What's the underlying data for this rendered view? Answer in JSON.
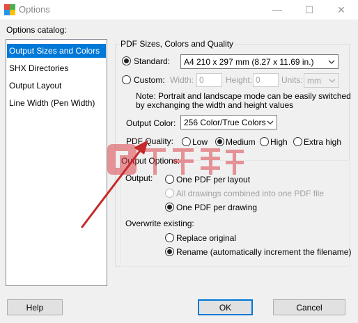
{
  "window": {
    "title": "Options",
    "minimize_glyph": "—",
    "maximize_glyph": "☐",
    "close_glyph": "✕"
  },
  "catalog": {
    "label": "Options catalog:",
    "items": [
      {
        "label": "Output Sizes and Colors",
        "selected": true
      },
      {
        "label": "SHX Directories",
        "selected": false
      },
      {
        "label": "Output Layout",
        "selected": false
      },
      {
        "label": "Line Width (Pen Width)",
        "selected": false
      }
    ]
  },
  "pdf_sizes": {
    "group_title": "PDF Sizes, Colors and Quality",
    "standard_label": "Standard:",
    "standard_value": "A4 210 x 297 mm (8.27 x 11.69 in.)",
    "custom_label": "Custom:",
    "width_label": "Width:",
    "width_value": "0",
    "height_label": "Height:",
    "height_value": "0",
    "units_label": "Units:",
    "units_value": "mm",
    "note_line1": "Note: Portrait and landscape mode can be easily switched",
    "note_line2": "by exchanging the width and height values",
    "output_color_label": "Output Color:",
    "output_color_value": "256 Color/True Colors",
    "quality_label": "PDF Quality:",
    "quality_options": [
      "Low",
      "Medium",
      "High",
      "Extra high"
    ],
    "quality_selected": "Medium",
    "page_size_mode": "Standard"
  },
  "output_options": {
    "group_title": "Output Options:",
    "output_label": "Output:",
    "output_choices": [
      {
        "label": "One PDF per layout",
        "checked": false,
        "enabled": true
      },
      {
        "label": "All drawings combined into one PDF file",
        "checked": false,
        "enabled": false
      },
      {
        "label": "One PDF per drawing",
        "checked": true,
        "enabled": true
      }
    ],
    "overwrite_label": "Overwrite existing:",
    "overwrite_choices": [
      {
        "label": "Replace original",
        "checked": false
      },
      {
        "label": "Rename (automatically increment the filename)",
        "checked": true
      }
    ]
  },
  "buttons": {
    "help": "Help",
    "ok": "OK",
    "cancel": "Cancel"
  },
  "colors": {
    "selection": "#0078d7",
    "annotation_arrow": "#c62a2a",
    "watermark_red": "#d9363e"
  },
  "icons": {
    "app": "app-icon",
    "dropdown": "chevron-down-icon",
    "annotation": "red-arrow-annotation",
    "watermark": "watermark-logo"
  }
}
